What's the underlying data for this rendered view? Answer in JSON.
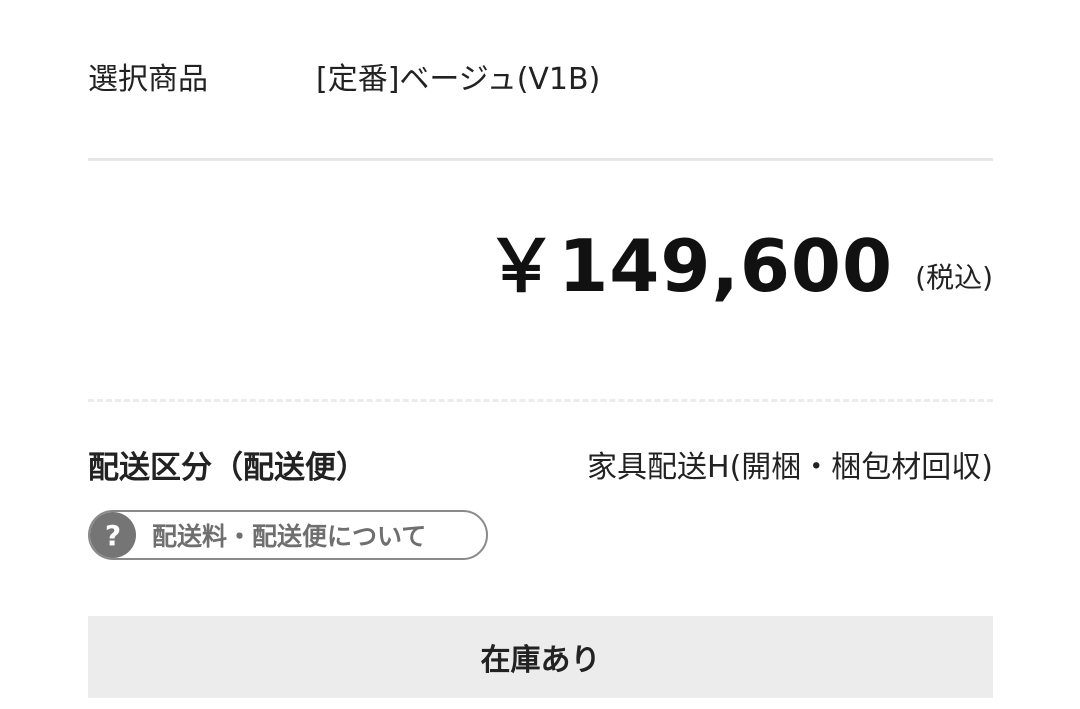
{
  "selected_product": {
    "label": "選択商品",
    "value": "[定番]ベージュ(V1B)"
  },
  "price": {
    "amount": "￥149,600",
    "tax_note": "(税込)"
  },
  "shipping": {
    "label": "配送区分（配送便）",
    "value": "家具配送H(開梱・梱包材回収)"
  },
  "info_link": {
    "icon": "question-icon",
    "icon_glyph": "?",
    "label": "配送料・配送便について"
  },
  "stock": {
    "status": "在庫あり"
  },
  "colors": {
    "divider": "#e6e6e6",
    "pill_border": "#8a8a8a",
    "icon_bg": "#757575",
    "stock_bg": "#ececec"
  }
}
